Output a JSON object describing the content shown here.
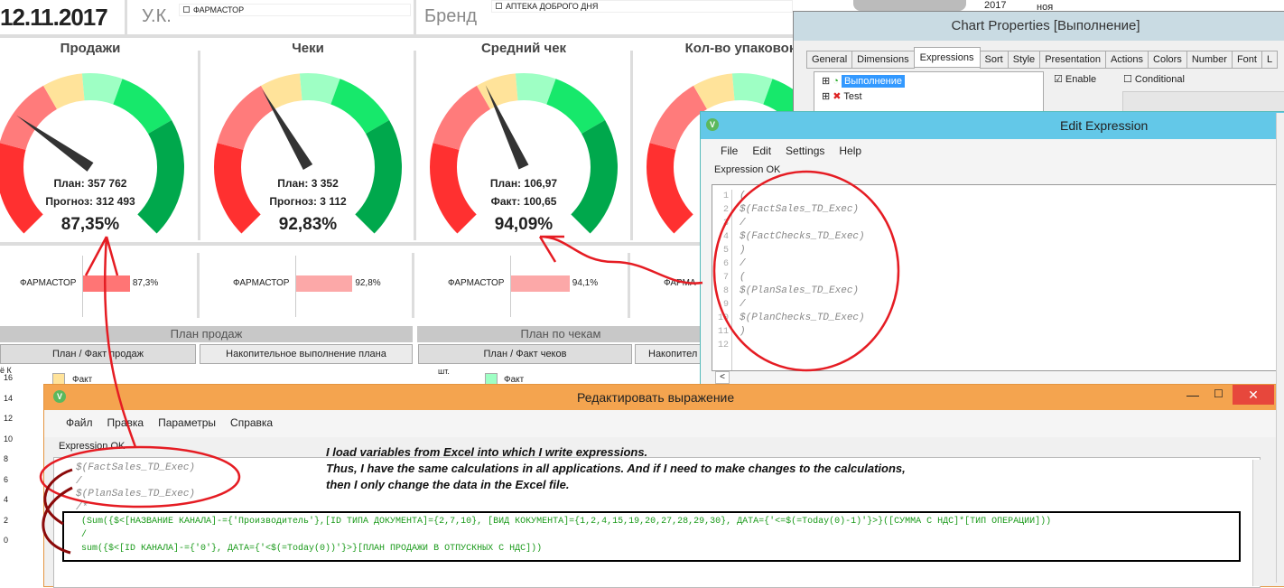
{
  "header": {
    "date": "12.11.2017",
    "uk_label": "У.К.",
    "uk_value": "ФАРМАСТОР",
    "brand_label": "Бренд",
    "brand_value": "АПТЕКА ДОБРОГО ДНЯ",
    "year": "2017",
    "month": "ноя"
  },
  "gauges": [
    {
      "title": "Продажи",
      "line1": "План: 357 762",
      "line2": "Прогноз: 312 493",
      "pct": "87,35%",
      "value": 87.35
    },
    {
      "title": "Чеки",
      "line1": "План: 3 352",
      "line2": "Прогноз: 3 112",
      "pct": "92,83%",
      "value": 92.83
    },
    {
      "title": "Средний чек",
      "line1": "План: 106,97",
      "line2": "Факт: 100,65",
      "pct": "94,09%",
      "value": 94.09
    },
    {
      "title": "Кол-во упаковок",
      "value": null
    }
  ],
  "gauge_colors": [
    "#ff3030",
    "#ff7b7b",
    "#ffe39a",
    "#9effc4",
    "#17e86b",
    "#00a84c"
  ],
  "bars": [
    {
      "label": "ФАРМАСТОР",
      "pct": "87,3%",
      "value": 87.3,
      "color": "#ff7575"
    },
    {
      "label": "ФАРМАСТОР",
      "pct": "92,8%",
      "value": 92.8,
      "color": "#fca8a8"
    },
    {
      "label": "ФАРМАСТОР",
      "pct": "94,1%",
      "value": 94.1,
      "color": "#fca8a8"
    },
    {
      "label": "ФАРМА"
    }
  ],
  "sections": {
    "sales": "План продаж",
    "checks": "План по чекам",
    "btn_sales_plan": "План / Факт продаж",
    "btn_sales_cum": "Накопительное выполнение плана",
    "btn_checks_plan": "План / Факт чеков",
    "btn_checks_cum": "Накопител",
    "legend_fact": "Факт",
    "unit_checks": "шт.",
    "unit_sales": "ё К"
  },
  "axis_ticks": [
    "16",
    "14",
    "12",
    "10",
    "8",
    "6",
    "4",
    "2",
    "0"
  ],
  "chart_props": {
    "title": "Chart Properties [Выполнение]",
    "tabs": [
      "General",
      "Dimensions",
      "Expressions",
      "Sort",
      "Style",
      "Presentation",
      "Actions",
      "Colors",
      "Number",
      "Font",
      "L"
    ],
    "active_tab": "Expressions",
    "tree": [
      "Выполнение",
      "Test"
    ],
    "enable": "Enable",
    "conditional": "Conditional"
  },
  "edit_expr": {
    "title": "Edit Expression",
    "menu": [
      "File",
      "Edit",
      "Settings",
      "Help"
    ],
    "status": "Expression OK",
    "lines": [
      "(",
      "$(FactSales_TD_Exec)",
      "/",
      "$(FactChecks_TD_Exec)",
      ")",
      "/",
      "(",
      "$(PlanSales_TD_Exec)",
      "/",
      "$(PlanChecks_TD_Exec)",
      ")",
      ""
    ]
  },
  "ru_expr": {
    "title": "Редактировать выражение",
    "menu": [
      "Файл",
      "Правка",
      "Параметры",
      "Справка"
    ],
    "status": "Expression OK",
    "lines": [
      "$(FactSales_TD_Exec)",
      "/",
      "$(PlanSales_TD_Exec)",
      "/*"
    ],
    "code": [
      "(Sum({$<[НАЗВАНИЕ КАНАЛА]-={'Производитель'},[ID ТИПА ДОКУМЕНТА]={2,7,10}, [ВИД КОКУМЕНТА]={1,2,4,15,19,20,27,28,29,30}, ДАТА={'<=$(=Today(0)-1)'}>}([СУММА С НДС]*[ТИП ОПЕРАЦИИ]))",
      "/",
      "sum({$<[ID КАНАЛА]-={'0'}, ДАТА={'<$(=Today(0))'}>}[ПЛАН ПРОДАЖИ В ОТПУСКНЫХ С НДС]))"
    ]
  },
  "annotation": [
    "I load variables from Excel into which I write expressions.",
    "Thus, I have the same calculations in all applications. And if I need to make changes to the calculations,",
    "then I only change the data in the Excel file."
  ]
}
